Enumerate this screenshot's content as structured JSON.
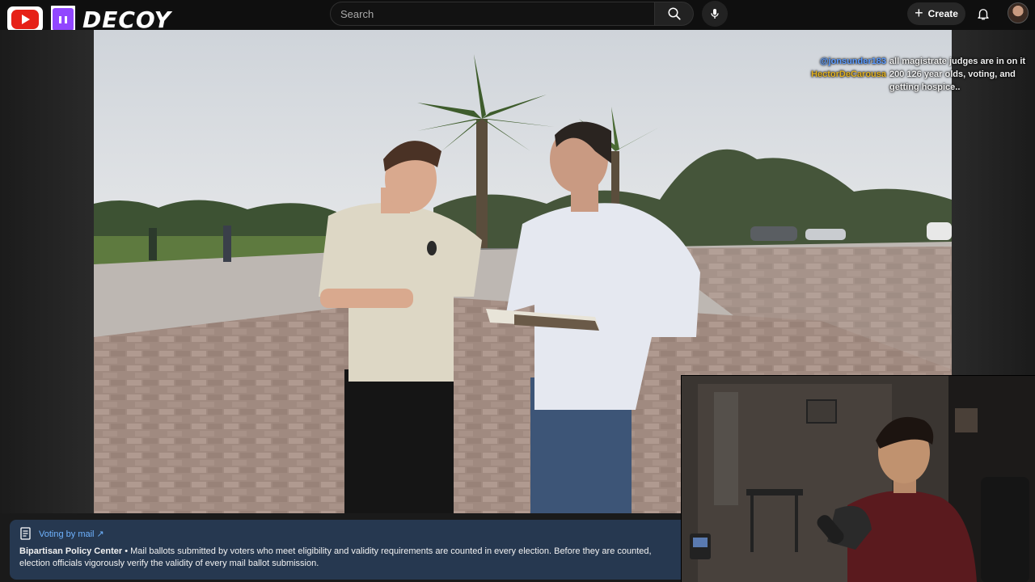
{
  "channel": {
    "brand": "DECOY"
  },
  "header": {
    "search_placeholder": "Search",
    "create_label": "Create"
  },
  "chat": [
    {
      "user": "@jonsunder183",
      "message": "all magistrate judges are in on it"
    },
    {
      "user": "HectorDeCarousa",
      "message": "200 126 year olds, voting, and getting hospice.."
    }
  ],
  "info_panel": {
    "topic": "Voting by mail",
    "source": "Bipartisan Policy Center",
    "separator": " • ",
    "text": "Mail ballots submitted by voters who meet eligibility and validity requirements are counted in every election. Before they are counted, election officials vigorously verify the validity of every mail ballot submission."
  },
  "colors": {
    "youtube_red": "#e62117",
    "twitch_purple": "#9146ff",
    "link_blue": "#6fb3ff",
    "info_bg": "#263850"
  }
}
